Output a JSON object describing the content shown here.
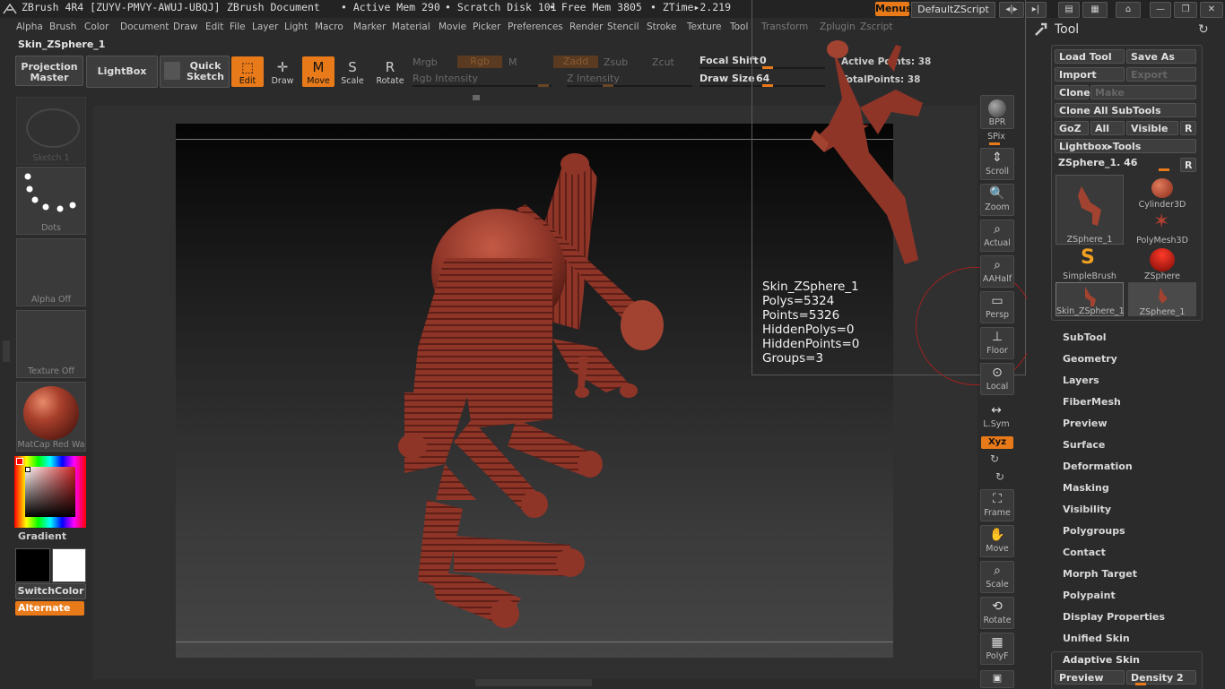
{
  "titlebar": {
    "app": "ZBrush 4R4 [ZUYV-PMVY-AWUJ-UBQJ]",
    "document": "ZBrush Document",
    "active_mem": "• Active Mem 290",
    "scratch_disk": "• Scratch Disk 101",
    "free_mem": "• Free Mem 3805",
    "ztime": "• ZTime▸2.219",
    "menus_label": "Menus",
    "zscript_label": "DefaultZScript"
  },
  "menubar": [
    "Alpha",
    "Brush",
    "Color",
    "Document",
    "Draw",
    "Edit",
    "File",
    "Layer",
    "Light",
    "Macro",
    "Marker",
    "Material",
    "Movie",
    "Picker",
    "Preferences",
    "Render",
    "Stencil",
    "Stroke",
    "Texture",
    "Tool",
    "Transform",
    "Zplugin",
    "Zscript"
  ],
  "document_name": "Skin_ZSphere_1",
  "toolbar": {
    "projection_master": "Projection Master",
    "lightbox": "LightBox",
    "quick_sketch": "Quick Sketch",
    "edit": "Edit",
    "draw": "Draw",
    "move": "Move",
    "scale": "Scale",
    "rotate": "Rotate",
    "mrgb": "Mrgb",
    "rgb": "Rgb",
    "m": "M",
    "zadd": "Zadd",
    "zsub": "Zsub",
    "zcut": "Zcut",
    "rgb_intensity": "Rgb Intensity",
    "z_intensity": "Z Intensity",
    "focal_shift_label": "Focal Shift",
    "focal_shift_value": "0",
    "draw_size_label": "Draw Size",
    "draw_size_value": "64",
    "active_points": "Active Points: 38",
    "total_points": "TotalPoints: 38"
  },
  "left_shelf": {
    "sketch": "Sketch 1",
    "dots": "Dots",
    "alpha": "Alpha  Off",
    "texture": "Texture  Off",
    "material": "MatCap  Red  Wa",
    "gradient": "Gradient",
    "switchcolor": "SwitchColor",
    "alternate": "Alternate"
  },
  "right_shelf": {
    "bpr": "BPR",
    "spix": "SPix",
    "scroll": "Scroll",
    "zoom": "Zoom",
    "actual": "Actual",
    "aahalf": "AAHalf",
    "persp": "Persp",
    "floor": "Floor",
    "local": "Local",
    "lsym": "L.Sym",
    "xyz": "Xyz",
    "frame": "Frame",
    "move": "Move",
    "scale": "Scale",
    "rotate": "Rotate",
    "polyf": "PolyF"
  },
  "info": {
    "name": "Skin_ZSphere_1",
    "polys": "Polys=5324",
    "points": "Points=5326",
    "hidden_polys": "HiddenPolys=0",
    "hidden_points": "HiddenPoints=0",
    "groups": "Groups=3"
  },
  "tool_panel": {
    "title": "Tool",
    "load_tool": "Load Tool",
    "save_as": "Save As",
    "import": "Import",
    "export": "Export",
    "clone": "Clone",
    "make_polymesh": "Make PolyMesh3D",
    "clone_all": "Clone  All  SubTools",
    "goz": "GoZ",
    "all": "All",
    "visible": "Visible",
    "r": "R",
    "lightbox_tools": "Lightbox▸Tools",
    "current_tool": "ZSphere_1. 46",
    "slots": [
      {
        "label": "ZSphere_1"
      },
      {
        "label": "Cylinder3D"
      },
      {
        "label": "PolyMesh3D"
      },
      {
        "label": "SimpleBrush"
      },
      {
        "label": "ZSphere"
      },
      {
        "label": "Skin_ZSphere_1"
      },
      {
        "label": "ZSphere_1"
      }
    ],
    "subpalettes": [
      "SubTool",
      "Geometry",
      "Layers",
      "FiberMesh",
      "Preview",
      "Surface",
      "Deformation",
      "Masking",
      "Visibility",
      "Polygroups",
      "Contact",
      "Morph Target",
      "Polypaint",
      "Display Properties",
      "Unified Skin"
    ],
    "adaptive_skin": "Adaptive Skin",
    "preview": "Preview",
    "density": "Density 2"
  },
  "colors": {
    "accent": "#e87a1a",
    "model": "#9a3a2c",
    "background": "#2b2b2b"
  }
}
